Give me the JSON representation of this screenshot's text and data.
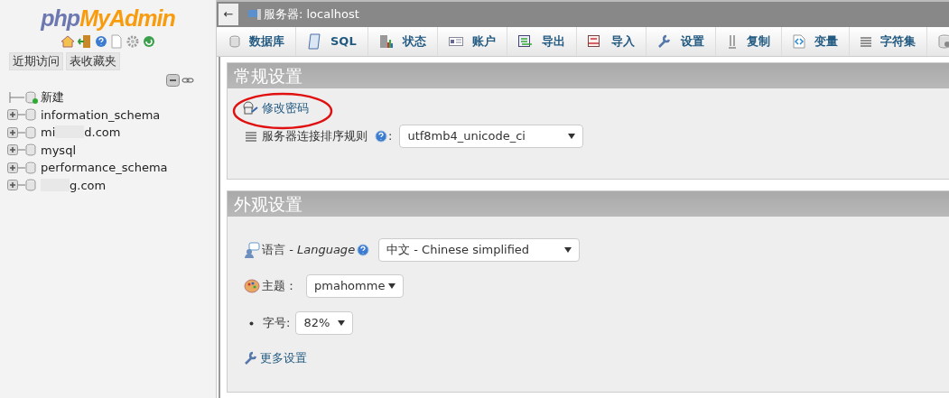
{
  "sidebar": {
    "logo_start": "php",
    "logo_end": "MyAdmin",
    "tabs": [
      "近期访问",
      "表收藏夹"
    ],
    "tree": [
      {
        "name": "新建",
        "kind": "new"
      },
      {
        "name": "information_schema",
        "kind": "db"
      },
      {
        "name_start": "mi",
        "name_end": "d.com",
        "kind": "redacted"
      },
      {
        "name": "mysql",
        "kind": "db"
      },
      {
        "name": "performance_schema",
        "kind": "db"
      },
      {
        "name_end": "g.com",
        "kind": "redacted"
      }
    ]
  },
  "topbar": {
    "back": "←",
    "breadcrumb": "服务器: localhost"
  },
  "tabs": [
    {
      "label": "数据库",
      "kind": "text"
    },
    {
      "label": "SQL",
      "kind": "text"
    },
    {
      "label": "状态",
      "kind": "text"
    },
    {
      "label": "账户",
      "kind": "text"
    },
    {
      "label": "导出",
      "kind": "text"
    },
    {
      "label": "导入",
      "kind": "text"
    },
    {
      "label": "设置",
      "kind": "text"
    },
    {
      "label": "复制",
      "kind": "text"
    },
    {
      "label": "变量",
      "kind": "text"
    },
    {
      "label": "字符集",
      "kind": "text"
    },
    {
      "kind": "icon_only"
    }
  ],
  "general": {
    "title": "常规设置",
    "change_password": "修改密码",
    "collation_label": "服务器连接排序规则",
    "collation_colon": ":",
    "collation_value": "utf8mb4_unicode_ci"
  },
  "appearance": {
    "title": "外观设置",
    "language_label": "语言 - ",
    "language_italic": "Language",
    "language_value": "中文 - Chinese simplified",
    "theme_label": "主题：",
    "theme_value": "pmahomme",
    "font_label": "字号:",
    "font_value": "82%",
    "more": "更多设置"
  }
}
